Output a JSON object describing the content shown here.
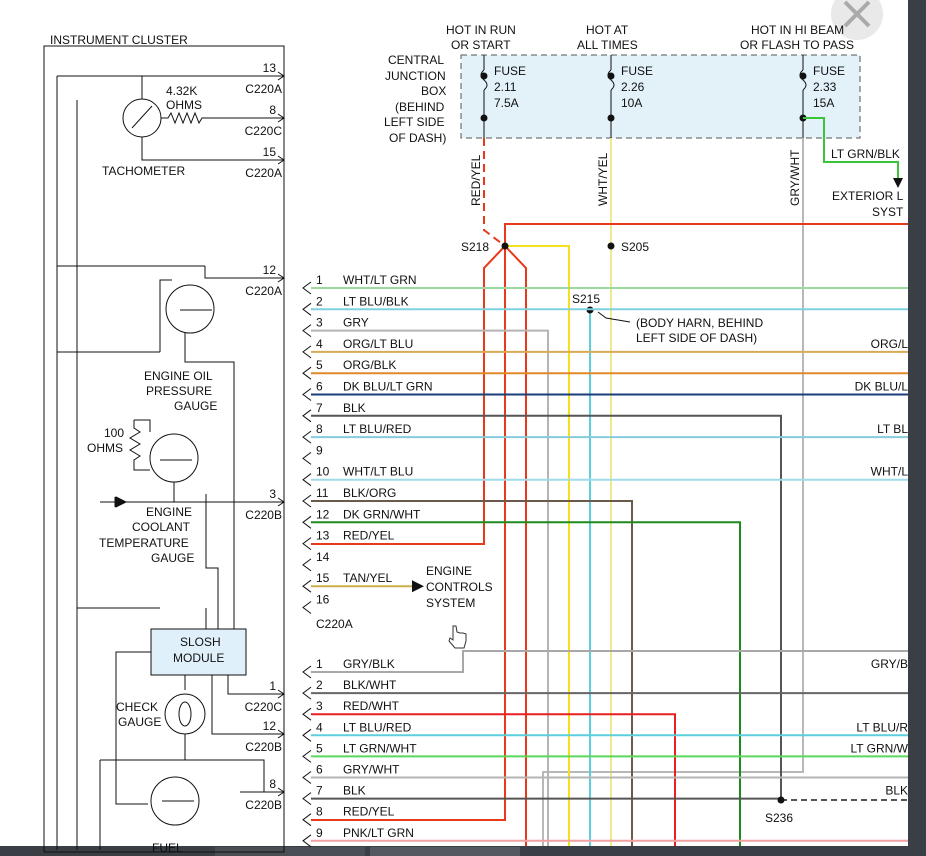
{
  "cluster": {
    "title": "INSTRUMENT CLUSTER",
    "tachometer": "TACHOMETER",
    "tach_resistor": [
      "4.32K",
      "OHMS"
    ],
    "oil_gauge": [
      "ENGINE OIL",
      "PRESSURE",
      "GAUGE"
    ],
    "coolant_resistor": [
      "100",
      "OHMS"
    ],
    "coolant_gauge": [
      "ENGINE",
      "COOLANT",
      "TEMPERATURE",
      "GAUGE"
    ],
    "slosh_module": [
      "SLOSH",
      "MODULE"
    ],
    "check_gauge": [
      "CHECK",
      "GAUGE"
    ],
    "fuel_gauge": "FUEL",
    "pins": [
      {
        "num": "13",
        "conn": "C220A"
      },
      {
        "num": "8",
        "conn": "C220C"
      },
      {
        "num": "15",
        "conn": "C220A"
      },
      {
        "num": "12",
        "conn": "C220A"
      },
      {
        "num": "3",
        "conn": "C220B"
      },
      {
        "num": "1",
        "conn": "C220C"
      },
      {
        "num": "12",
        "conn": "C220B"
      },
      {
        "num": "8",
        "conn": "C220B"
      }
    ]
  },
  "junction_box": {
    "label": [
      "CENTRAL",
      "JUNCTION",
      "BOX",
      "(BEHIND",
      "LEFT SIDE",
      "OF DASH)"
    ],
    "fuses": [
      {
        "header": [
          "HOT IN RUN",
          "OR START"
        ],
        "name": "FUSE",
        "num": "2.11",
        "amps": "7.5A",
        "wire": "RED/YEL"
      },
      {
        "header": [
          "HOT AT",
          "ALL TIMES"
        ],
        "name": "FUSE",
        "num": "2.26",
        "amps": "10A",
        "wire": "WHT/YEL"
      },
      {
        "header": [
          "HOT IN HI BEAM",
          "OR FLASH TO PASS"
        ],
        "name": "FUSE",
        "num": "2.33",
        "amps": "15A",
        "wire": "GRY/WHT"
      }
    ],
    "out_wire": "LT GRN/BLK",
    "exterior": [
      "EXTERIOR L",
      "SYST"
    ]
  },
  "splices": {
    "s218": "S218",
    "s205": "S205",
    "s215": "S215",
    "s215_note": [
      "(BODY HARN, BEHIND",
      "LEFT SIDE OF DASH)"
    ],
    "s236": "S236"
  },
  "connector_a": {
    "name": "C220A",
    "rows": [
      {
        "pin": "1",
        "wire": "WHT/LT GRN",
        "color": "#9fd89f",
        "right": ""
      },
      {
        "pin": "2",
        "wire": "LT BLU/BLK",
        "color": "#7fd0e0",
        "right": ""
      },
      {
        "pin": "3",
        "wire": "GRY",
        "color": "#b4b4b4",
        "right": ""
      },
      {
        "pin": "4",
        "wire": "ORG/LT BLU",
        "color": "#d8aa55",
        "right": "ORG/L"
      },
      {
        "pin": "5",
        "wire": "ORG/BLK",
        "color": "#e0882a",
        "right": ""
      },
      {
        "pin": "6",
        "wire": "DK BLU/LT GRN",
        "color": "#1a3d7a",
        "right": "DK BLU/L"
      },
      {
        "pin": "7",
        "wire": "BLK",
        "color": "#555555",
        "right": ""
      },
      {
        "pin": "8",
        "wire": "LT BLU/RED",
        "color": "#86ccdd",
        "right": "LT BL"
      },
      {
        "pin": "9",
        "wire": "",
        "color": "",
        "right": ""
      },
      {
        "pin": "10",
        "wire": "WHT/LT BLU",
        "color": "#9fdbe8",
        "right": "WHT/L"
      },
      {
        "pin": "11",
        "wire": "BLK/ORG",
        "color": "#6a5a4a",
        "right": ""
      },
      {
        "pin": "12",
        "wire": "DK GRN/WHT",
        "color": "#1e8a1e",
        "right": ""
      },
      {
        "pin": "13",
        "wire": "RED/YEL",
        "color": "#e83a1a",
        "right": ""
      },
      {
        "pin": "14",
        "wire": "",
        "color": "",
        "right": ""
      },
      {
        "pin": "15",
        "wire": "TAN/YEL",
        "color": "#c9b04a",
        "right": ""
      },
      {
        "pin": "16",
        "wire": "",
        "color": "",
        "right": ""
      }
    ],
    "engine_controls": [
      "ENGINE",
      "CONTROLS",
      "SYSTEM"
    ]
  },
  "connector_b": {
    "rows": [
      {
        "pin": "1",
        "wire": "GRY/BLK",
        "color": "#a8a8a8",
        "right": "GRY/B"
      },
      {
        "pin": "2",
        "wire": "BLK/WHT",
        "color": "#666666",
        "right": ""
      },
      {
        "pin": "3",
        "wire": "RED/WHT",
        "color": "#e82020",
        "right": ""
      },
      {
        "pin": "4",
        "wire": "LT BLU/RED",
        "color": "#5ccfdf",
        "right": "LT BLU/R"
      },
      {
        "pin": "5",
        "wire": "LT GRN/WHT",
        "color": "#5bd85b",
        "right": "LT GRN/W"
      },
      {
        "pin": "6",
        "wire": "GRY/WHT",
        "color": "#b4b4b4",
        "right": ""
      },
      {
        "pin": "7",
        "wire": "BLK",
        "color": "#555555",
        "right": "BLK"
      },
      {
        "pin": "8",
        "wire": "RED/YEL",
        "color": "#e83a1a",
        "right": ""
      },
      {
        "pin": "9",
        "wire": "PNK/LT GRN",
        "color": "#f0a0a0",
        "right": ""
      }
    ]
  },
  "wire_colors": {
    "red_yel": "#e83a1a",
    "wht_yel": "#f0e88a",
    "gry_wht": "#b8b8b8",
    "yellow": "#f2e21a",
    "lt_blu": "#5ccfdf",
    "lt_grn_blk": "#3ac43a",
    "jbox_fill": "#e3f1f8",
    "slosh_fill": "#dff0fa"
  }
}
